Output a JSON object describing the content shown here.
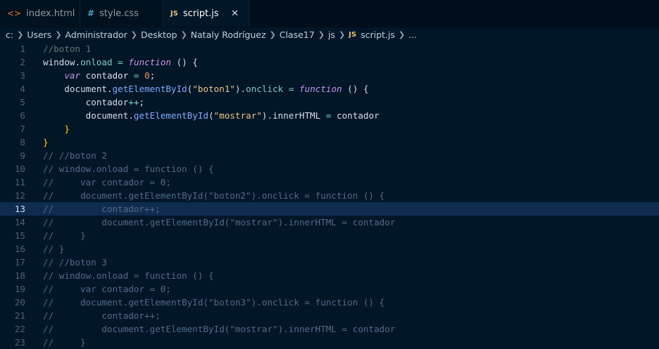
{
  "tabs": [
    {
      "label": "index.html",
      "icon": "html-icon",
      "glyph": "<>"
    },
    {
      "label": "style.css",
      "icon": "css-icon",
      "glyph": "#"
    },
    {
      "label": "script.js",
      "icon": "js-icon",
      "glyph": "JS",
      "active": true
    }
  ],
  "close_glyph": "✕",
  "breadcrumb": [
    "c:",
    "Users",
    "Administrador",
    "Desktop",
    "Nataly Rodríguez",
    "Clase17",
    "js",
    "script.js",
    "..."
  ],
  "breadcrumb_js_badge": "JS",
  "active_line": 13,
  "lines": [
    "//boton 1",
    "window.onload = function () {",
    "    var contador = 0;",
    "    document.getElementById(\"boton1\").onclick = function () {",
    "        contador++;",
    "        document.getElementById(\"mostrar\").innerHTML = contador",
    "    }",
    "}",
    "// //boton 2",
    "// window.onload = function () {",
    "//     var contador = 0;",
    "//     document.getElementById(\"boton2\").onclick = function () {",
    "//         contador++;",
    "//         document.getElementById(\"mostrar\").innerHTML = contador",
    "//     }",
    "// }",
    "// //boton 3",
    "// window.onload = function () {",
    "//     var contador = 0;",
    "//     document.getElementById(\"boton3\").onclick = function () {",
    "//         contador++;",
    "//         document.getElementById(\"mostrar\").innerHTML = contador",
    "//     }"
  ],
  "colors": {
    "background": "#011627",
    "active_line": "#0e2c4f"
  }
}
